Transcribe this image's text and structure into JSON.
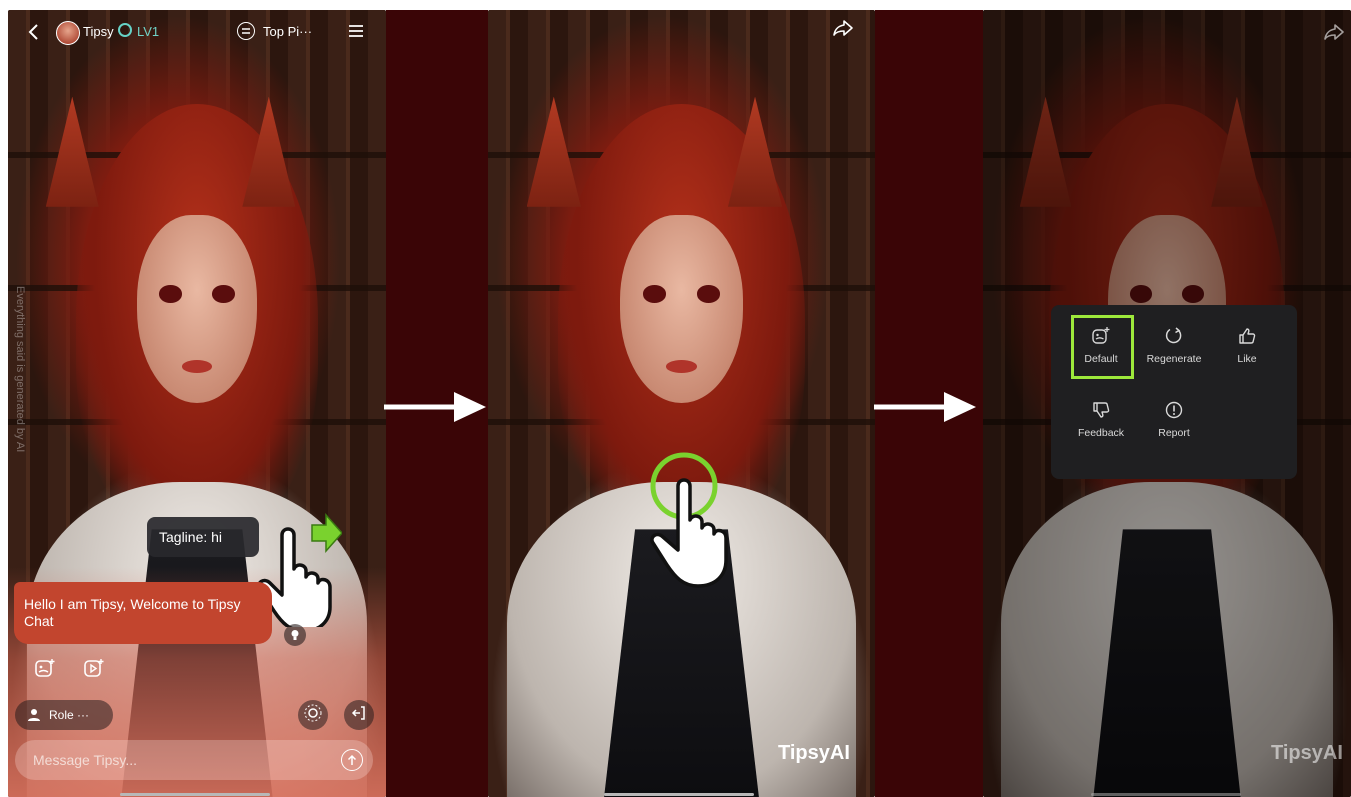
{
  "colors": {
    "accent_green": "#9de83b",
    "bubble": "#c2452e",
    "maroon": "#3a0506",
    "menu_bg": "#1f1f21"
  },
  "panel1": {
    "header": {
      "back_icon": "chevron-left-icon",
      "character_name": "Tipsy",
      "level_badge": "LV1",
      "chat_mode_label": "Top Pi···",
      "menu_icon": "hamburger-icon"
    },
    "side_disclaimer": "Everything said is generated by AI",
    "tagline": "Tagline: hi",
    "greeting_message": "Hello I am Tipsy, Welcome to Tipsy Chat",
    "role_button_label": "Role ···",
    "message_placeholder": "Message Tipsy..."
  },
  "panel2": {
    "share_icon": "share-icon",
    "watermark": "TipsyAI"
  },
  "panel3": {
    "share_icon": "share-icon",
    "watermark": "TipsyAI",
    "context_menu": {
      "items": [
        {
          "label": "Default",
          "icon": "image-sparkle-icon"
        },
        {
          "label": "Regenerate",
          "icon": "refresh-icon"
        },
        {
          "label": "Like",
          "icon": "thumbs-up-icon"
        },
        {
          "label": "Feedback",
          "icon": "thumbs-down-icon"
        },
        {
          "label": "Report",
          "icon": "alert-circle-icon"
        }
      ]
    }
  }
}
